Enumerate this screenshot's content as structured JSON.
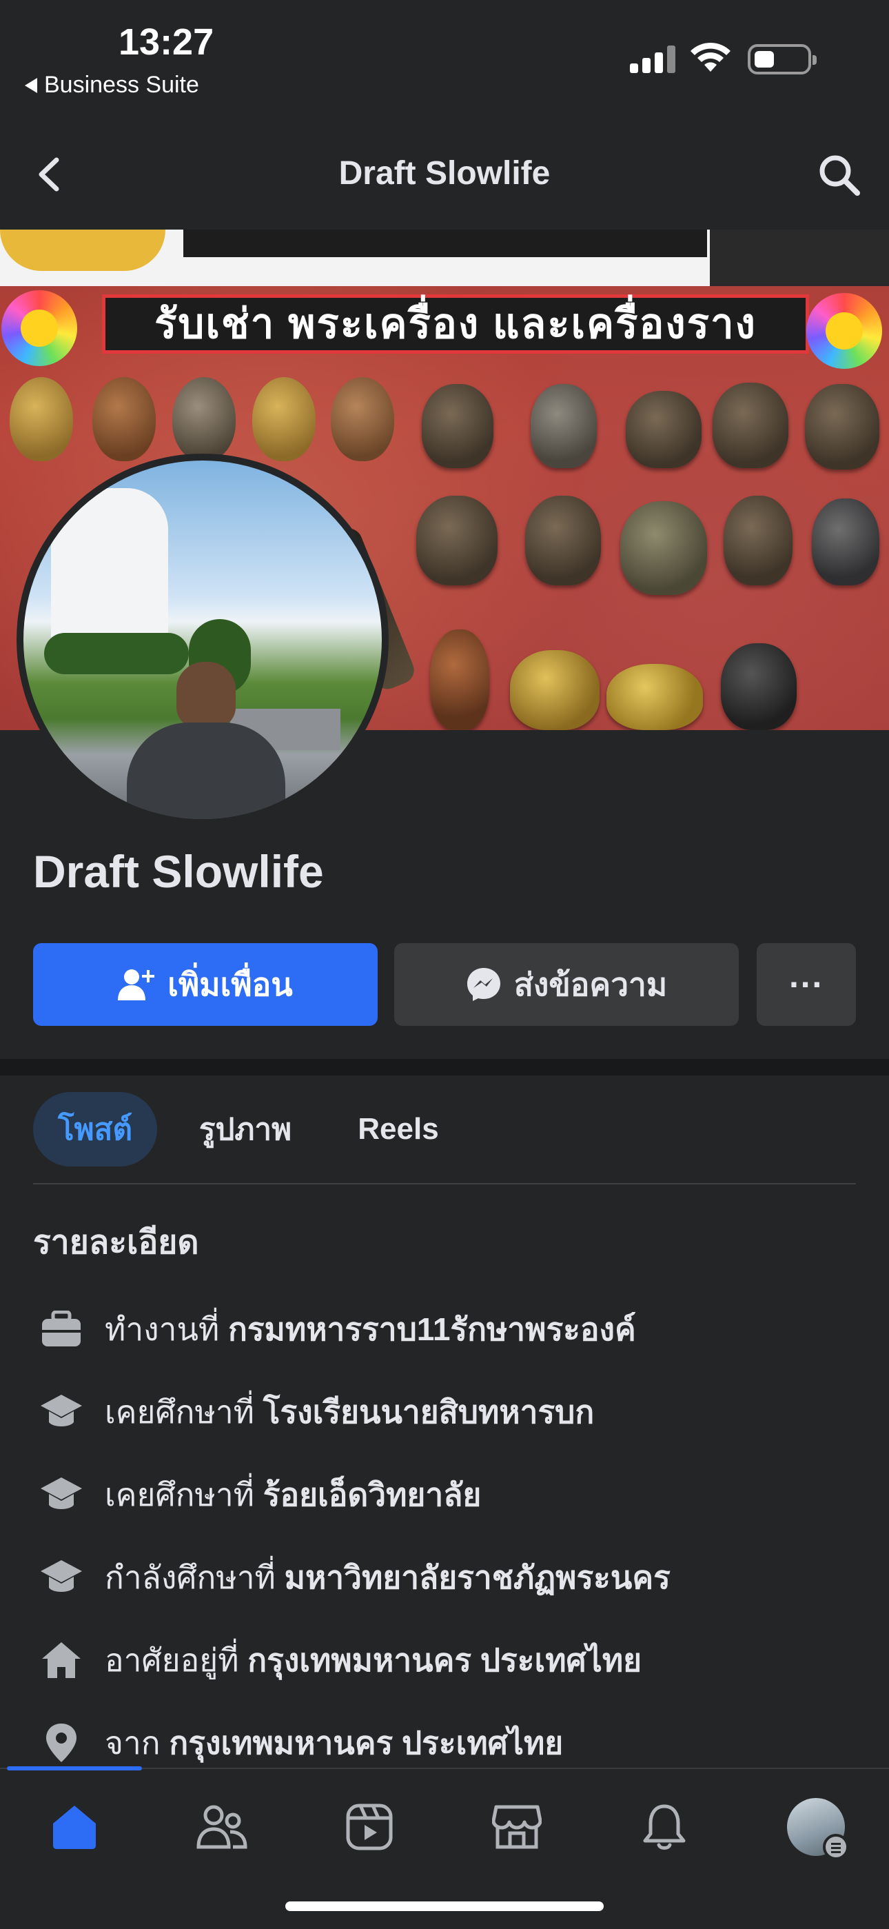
{
  "status_bar": {
    "time": "13:27",
    "back_app": "Business Suite"
  },
  "nav": {
    "title": "Draft Slowlife"
  },
  "cover": {
    "banner_text": "รับเช่า พระเครื่อง และเครื่องราง"
  },
  "profile": {
    "name": "Draft Slowlife"
  },
  "actions": {
    "add_friend": "เพิ่มเพื่อน",
    "message": "ส่งข้อความ",
    "more": "···"
  },
  "tabs": [
    {
      "label": "โพสต์",
      "active": true
    },
    {
      "label": "รูปภาพ",
      "active": false
    },
    {
      "label": "Reels",
      "active": false
    }
  ],
  "details": {
    "heading": "รายละเอียด",
    "items": [
      {
        "icon": "briefcase-icon",
        "prefix": "ทำงานที่",
        "value": "กรมทหารราบ11รักษาพระองค์"
      },
      {
        "icon": "graduation-cap-icon",
        "prefix": "เคยศึกษาที่",
        "value": "โรงเรียนนายสิบทหารบก"
      },
      {
        "icon": "graduation-cap-icon",
        "prefix": "เคยศึกษาที่",
        "value": "ร้อยเอ็ดวิทยาลัย"
      },
      {
        "icon": "graduation-cap-icon",
        "prefix": "กำลังศึกษาที่",
        "value": "มหาวิทยาลัยราชภัฏพระนคร"
      },
      {
        "icon": "home-icon",
        "prefix": "อาศัยอยู่ที่",
        "value": "กรุงเทพมหานคร ประเทศไทย"
      },
      {
        "icon": "location-pin-icon",
        "prefix": "จาก",
        "value": "กรุงเทพมหานคร ประเทศไทย"
      }
    ]
  },
  "colors": {
    "accent": "#2d6cf5",
    "background": "#242526",
    "button_secondary": "#3a3b3c",
    "active_tab_text": "#4599ff"
  }
}
